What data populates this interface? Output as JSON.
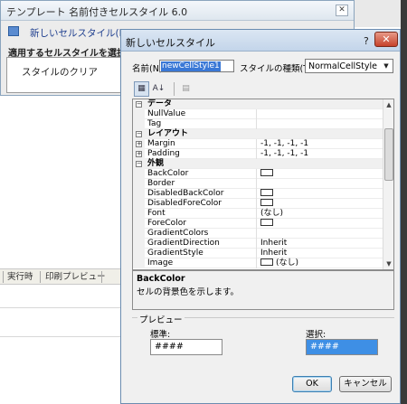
{
  "template_dialog": {
    "title": "テンプレート 名前付きセルスタイル 6.0",
    "close_glyph": "✕",
    "new_style_link": "新しいセルスタイル(N)...",
    "select_label": "適用するセルスタイルを選択:",
    "list_items": [
      "スタイルのクリア"
    ]
  },
  "background": {
    "tabs": [
      "実行時",
      "印刷プレビュー"
    ]
  },
  "dialog": {
    "title": "新しいセルスタイル",
    "help_glyph": "?",
    "close_glyph": "✕",
    "name_label": "名前(N):",
    "name_value": "newCellStyle1",
    "type_label": "スタイルの種類(T):",
    "type_value": "NormalCellStyle",
    "toolbar": {
      "categorized_icon": "categorized-icon",
      "alphabetical_icon": "alphabetical-icon",
      "property_pages_icon": "property-pages-icon"
    },
    "grid_rows": [
      {
        "kind": "category",
        "expander": "⊟",
        "name": "データ",
        "value": ""
      },
      {
        "kind": "property",
        "expander": "",
        "name": "NullValue",
        "value": ""
      },
      {
        "kind": "property",
        "expander": "",
        "name": "Tag",
        "value": ""
      },
      {
        "kind": "category",
        "expander": "⊟",
        "name": "レイアウト",
        "value": ""
      },
      {
        "kind": "property",
        "expander": "⊞",
        "name": "Margin",
        "value": "-1, -1, -1, -1"
      },
      {
        "kind": "property",
        "expander": "⊞",
        "name": "Padding",
        "value": "-1, -1, -1, -1"
      },
      {
        "kind": "category",
        "expander": "⊟",
        "name": "外観",
        "value": ""
      },
      {
        "kind": "property",
        "expander": "",
        "name": "BackColor",
        "value": "",
        "swatch": true
      },
      {
        "kind": "property",
        "expander": "",
        "name": "Border",
        "value": ""
      },
      {
        "kind": "property",
        "expander": "",
        "name": "DisabledBackColor",
        "value": "",
        "swatch": true
      },
      {
        "kind": "property",
        "expander": "",
        "name": "DisabledForeColor",
        "value": "",
        "swatch": true
      },
      {
        "kind": "property",
        "expander": "",
        "name": "Font",
        "value": "(なし)"
      },
      {
        "kind": "property",
        "expander": "",
        "name": "ForeColor",
        "value": "",
        "swatch": true
      },
      {
        "kind": "property",
        "expander": "",
        "name": "GradientColors",
        "value": ""
      },
      {
        "kind": "property",
        "expander": "",
        "name": "GradientDirection",
        "value": "Inherit"
      },
      {
        "kind": "property",
        "expander": "",
        "name": "GradientStyle",
        "value": "Inherit"
      },
      {
        "kind": "property",
        "expander": "",
        "name": "Image",
        "value": "(なし)",
        "swatch": true
      }
    ],
    "description": {
      "title": "BackColor",
      "text": "セルの背景色を示します。"
    },
    "preview": {
      "title": "プレビュー",
      "normal_label": "標準:",
      "normal_value": "####",
      "selected_label": "選択:",
      "selected_value": "####"
    },
    "ok_label": "OK",
    "cancel_label": "キャンセル"
  }
}
